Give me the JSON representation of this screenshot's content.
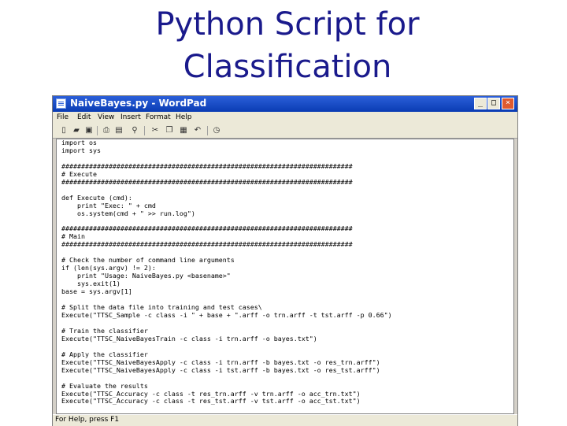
{
  "slide": {
    "title_line1": "Python Script for",
    "title_line2": "Classification"
  },
  "window": {
    "title": "NaiveBayes.py - WordPad",
    "controls": {
      "minimize": "_",
      "maximize": "□",
      "close": "×"
    }
  },
  "menu": [
    "File",
    "Edit",
    "View",
    "Insert",
    "Format",
    "Help"
  ],
  "toolbar": [
    "new-icon",
    "open-icon",
    "save-icon",
    "print-icon",
    "print-preview-icon",
    "find-icon",
    "cut-icon",
    "copy-icon",
    "paste-icon",
    "undo-icon",
    "date-time-icon"
  ],
  "document": {
    "lines": [
      "import os",
      "import sys",
      "",
      "##########################################################################",
      "# Execute",
      "##########################################################################",
      "",
      "def Execute (cmd):",
      "    print \"Exec: \" + cmd",
      "    os.system(cmd + \" >> run.log\")",
      "",
      "##########################################################################",
      "# Main",
      "##########################################################################",
      "",
      "# Check the number of command line arguments",
      "if (len(sys.argv) != 2):",
      "    print \"Usage: NaiveBayes.py <basename>\"",
      "    sys.exit(1)",
      "base = sys.argv[1]",
      "",
      "# Split the data file into training and test cases\\",
      "Execute(\"TTSC_Sample -c class -i \" + base + \".arff -o trn.arff -t tst.arff -p 0.66\")",
      "",
      "# Train the classifier",
      "Execute(\"TTSC_NaiveBayesTrain -c class -i trn.arff -o bayes.txt\")",
      "",
      "# Apply the classifier",
      "Execute(\"TTSC_NaiveBayesApply -c class -i trn.arff -b bayes.txt -o res_trn.arff\")",
      "Execute(\"TTSC_NaiveBayesApply -c class -i tst.arff -b bayes.txt -o res_tst.arff\")",
      "",
      "# Evaluate the results",
      "Execute(\"TTSC_Accuracy -c class -t res_trn.arff -v trn.arff -o acc_trn.txt\")",
      "Execute(\"TTSC_Accuracy -c class -t res_tst.arff -v tst.arff -o acc_tst.txt\")"
    ]
  },
  "status": {
    "text": "For Help, press F1"
  }
}
